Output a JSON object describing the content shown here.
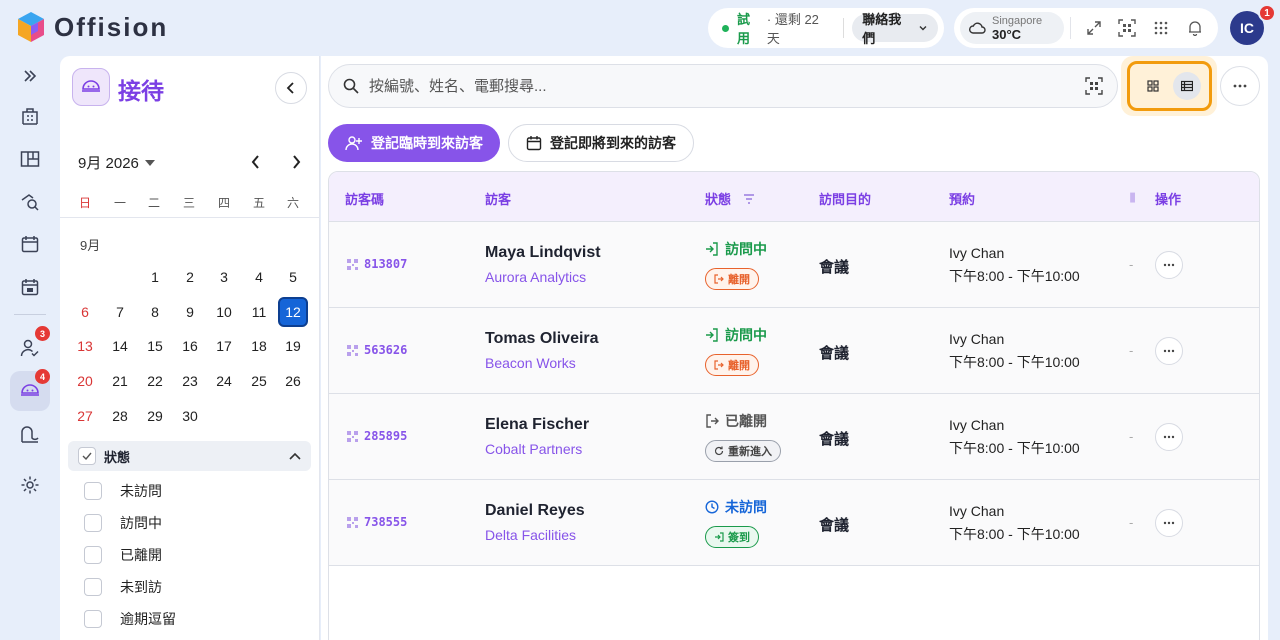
{
  "app": {
    "name": "Offision"
  },
  "topbar": {
    "trial_label": "試用",
    "trial_remaining": "· 還剩 22 天",
    "contact_label": "聯絡我們",
    "weather_city": "Singapore",
    "weather_temp": "30°C",
    "avatar_initials": "IC",
    "avatar_badge": "1"
  },
  "rail": {
    "badge_visitors_checkin": "3",
    "badge_reception": "4"
  },
  "page": {
    "title": "接待"
  },
  "calendar": {
    "month_title": "9月 2026",
    "weekdays": [
      "日",
      "一",
      "二",
      "三",
      "四",
      "五",
      "六"
    ],
    "month_label": "9月",
    "weeks": [
      [
        "",
        "",
        "1",
        "2",
        "3",
        "4",
        "5"
      ],
      [
        "6",
        "7",
        "8",
        "9",
        "10",
        "11",
        "12"
      ],
      [
        "13",
        "14",
        "15",
        "16",
        "17",
        "18",
        "19"
      ],
      [
        "20",
        "21",
        "22",
        "23",
        "24",
        "25",
        "26"
      ],
      [
        "27",
        "28",
        "29",
        "30",
        "",
        "",
        ""
      ]
    ],
    "selected_day": "12"
  },
  "filters": {
    "section_label": "狀態",
    "items": [
      "未訪問",
      "訪問中",
      "已離開",
      "未到訪",
      "逾期逗留"
    ]
  },
  "search": {
    "placeholder": "按編號、姓名、電郵搜尋..."
  },
  "actions": {
    "walkin_label": "登記臨時到來訪客",
    "preregister_label": "登記即將到來的訪客"
  },
  "table": {
    "headers": {
      "code": "訪客碼",
      "visitor": "訪客",
      "status": "狀態",
      "purpose": "訪問目的",
      "appointment": "預約",
      "actions": "操作"
    },
    "rows": [
      {
        "code": "813807",
        "name": "Maya Lindqvist",
        "company": "Aurora Analytics",
        "status": "訪問中",
        "action": "離開",
        "purpose": "會議",
        "host": "Ivy Chan",
        "time": "下午8:00 - 下午10:00",
        "extra": "-"
      },
      {
        "code": "563626",
        "name": "Tomas Oliveira",
        "company": "Beacon Works",
        "status": "訪問中",
        "action": "離開",
        "purpose": "會議",
        "host": "Ivy Chan",
        "time": "下午8:00 - 下午10:00",
        "extra": "-"
      },
      {
        "code": "285895",
        "name": "Elena Fischer",
        "company": "Cobalt Partners",
        "status": "已離開",
        "action": "重新進入",
        "purpose": "會議",
        "host": "Ivy Chan",
        "time": "下午8:00 - 下午10:00",
        "extra": "-"
      },
      {
        "code": "738555",
        "name": "Daniel Reyes",
        "company": "Delta Facilities",
        "status": "未訪問",
        "action": "簽到",
        "purpose": "會議",
        "host": "Ivy Chan",
        "time": "下午8:00 - 下午10:00",
        "extra": "-"
      }
    ]
  },
  "colors": {
    "brand": "#7b3fe4",
    "visiting": "#1a9a4b",
    "leave": "#e8622c",
    "not_visited": "#1565d8",
    "today": "#1565d8"
  }
}
